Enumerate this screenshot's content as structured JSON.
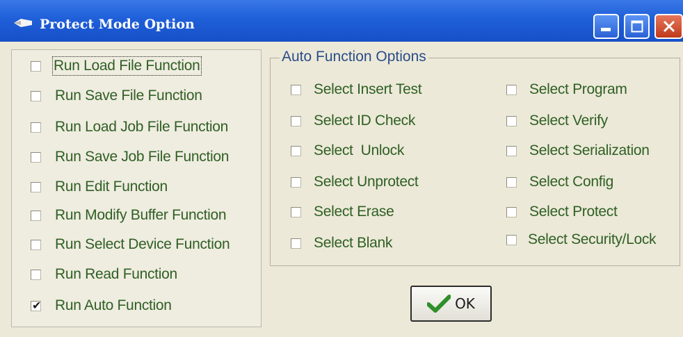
{
  "window": {
    "title": "Protect Mode Option",
    "accent": "#1f5fd8",
    "title_icon": "pin-icon",
    "buttons": [
      "minimize-icon",
      "maximize-icon",
      "close-icon"
    ]
  },
  "left_options": [
    {
      "label": "Run Load File Function",
      "checked": false,
      "focused": true
    },
    {
      "label": "Run Save File Function",
      "checked": false
    },
    {
      "label": "Run Load Job File Function",
      "checked": false
    },
    {
      "label": "Run Save Job File Function",
      "checked": false
    },
    {
      "label": "Run Edit Function",
      "checked": false
    },
    {
      "label": "Run Modify Buffer Function",
      "checked": false
    },
    {
      "label": "Run Select Device Function",
      "checked": false
    },
    {
      "label": "Run Read Function",
      "checked": false
    },
    {
      "label": "Run Auto Function",
      "checked": true
    }
  ],
  "auto_group": {
    "title": "Auto Function Options",
    "col1": [
      {
        "label": "Select Insert Test",
        "checked": false
      },
      {
        "label": "Select ID Check",
        "checked": false
      },
      {
        "label": "Select  Unlock",
        "checked": false
      },
      {
        "label": "Select Unprotect",
        "checked": false
      },
      {
        "label": "Select Erase",
        "checked": false
      },
      {
        "label": "Select Blank",
        "checked": false
      }
    ],
    "col2": [
      {
        "label": "Select Program",
        "checked": false
      },
      {
        "label": "Select Verify",
        "checked": false
      },
      {
        "label": "Select Serialization",
        "checked": false
      },
      {
        "label": "Select Config",
        "checked": false
      },
      {
        "label": "Select Protect",
        "checked": false
      },
      {
        "label": "Select Security/Lock",
        "checked": false
      }
    ]
  },
  "ok_button": {
    "label": "OK",
    "icon": "checkmark-icon"
  }
}
